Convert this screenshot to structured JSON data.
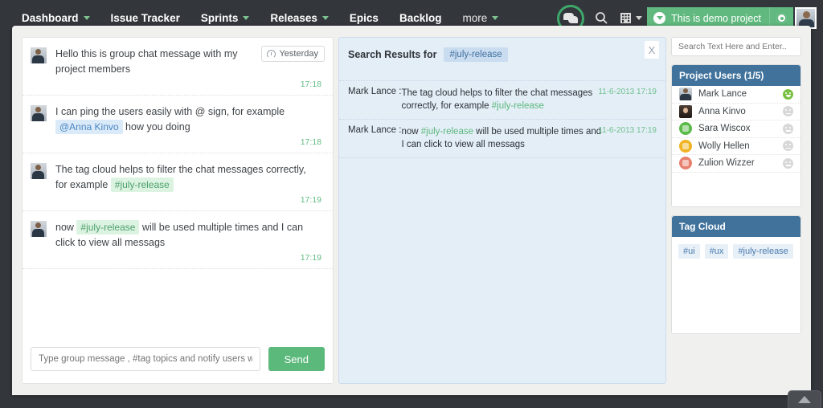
{
  "topnav": {
    "items": [
      {
        "label": "Dashboard",
        "caret": true
      },
      {
        "label": "Issue Tracker",
        "caret": false
      },
      {
        "label": "Sprints",
        "caret": true
      },
      {
        "label": "Releases",
        "caret": true
      },
      {
        "label": "Epics",
        "caret": false
      },
      {
        "label": "Backlog",
        "caret": false
      },
      {
        "label": "more",
        "caret": true
      }
    ],
    "icons": {
      "chat": "chat-bubble-icon",
      "search": "search-icon",
      "org": "building-icon"
    },
    "project_label": "This is demo project",
    "settings": "gear-icon",
    "avatar": "user-avatar",
    "highlight_color": "#3ea86a",
    "project_badge_color": "#61b97f"
  },
  "chat": {
    "yesterday_label": "Yesterday",
    "messages": [
      {
        "parts": [
          {
            "type": "text",
            "value": "Hello this is group chat message with my project members"
          }
        ],
        "time": "17:18",
        "has_day_badge": true
      },
      {
        "parts": [
          {
            "type": "text",
            "value": "I can ping the users easily with @ sign, for example "
          },
          {
            "type": "mention",
            "value": "@Anna Kinvo"
          },
          {
            "type": "text",
            "value": " how you doing"
          }
        ],
        "time": "17:18",
        "has_day_badge": false
      },
      {
        "parts": [
          {
            "type": "text",
            "value": "The tag cloud helps to filter the chat messages correctly, for example "
          },
          {
            "type": "tag",
            "value": "#july-release"
          }
        ],
        "time": "17:19",
        "has_day_badge": false
      },
      {
        "parts": [
          {
            "type": "text",
            "value": "now "
          },
          {
            "type": "tag",
            "value": "#july-release"
          },
          {
            "type": "text",
            "value": " will be used multiple times and I can click to view all messags"
          }
        ],
        "time": "17:19",
        "has_day_badge": false
      }
    ],
    "input_placeholder": "Type group message , #tag topics and notify users with @",
    "input_value": "",
    "send_label": "Send"
  },
  "search_results": {
    "title": "Search Results for",
    "query_tag": "#july-release",
    "close_label": "X",
    "rows": [
      {
        "author": "Mark Lance :",
        "parts": [
          {
            "type": "text",
            "value": "The tag cloud helps to filter the chat messages correctly, for example "
          },
          {
            "type": "tag",
            "value": "#july-release"
          }
        ],
        "stamp": "11-6-2013 17:19"
      },
      {
        "author": "Mark Lance :",
        "parts": [
          {
            "type": "text",
            "value": "now "
          },
          {
            "type": "tag",
            "value": "#july-release"
          },
          {
            "type": "text",
            "value": " will be used multiple times and I can click to view all messags"
          }
        ],
        "stamp": "11-6-2013 17:19"
      }
    ]
  },
  "sidebar": {
    "search_placeholder": "Search Text Here and Enter..",
    "search_value": "",
    "users_title": "Project Users (1/5)",
    "users": [
      {
        "name": "Mark Lance",
        "online": true,
        "avatar": "photo"
      },
      {
        "name": "Anna Kinvo",
        "online": false,
        "avatar": "photo2"
      },
      {
        "name": "Sara Wiscox",
        "online": false,
        "avatar": "color",
        "color": "#5bbb4a"
      },
      {
        "name": "Wolly Hellen",
        "online": false,
        "avatar": "color",
        "color": "#f0b323"
      },
      {
        "name": "Zulion Wizzer",
        "online": false,
        "avatar": "color",
        "color": "#e8806f"
      }
    ],
    "tagcloud_title": "Tag Cloud",
    "tags": [
      "#ui",
      "#ux",
      "#july-release"
    ]
  },
  "footer": {
    "scroll_top_icon": "arrow-up-icon"
  }
}
